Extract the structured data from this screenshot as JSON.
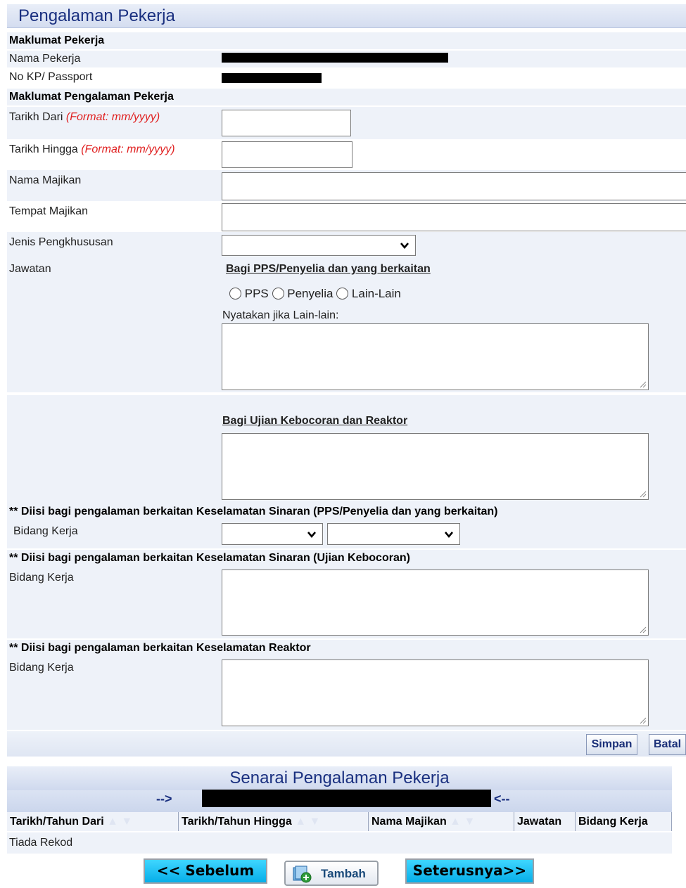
{
  "header": {
    "title": "Pengalaman Pekerja"
  },
  "maklumat_pekerja": {
    "title": "Maklumat Pekerja",
    "nama_label": "Nama Pekerja",
    "kp_label": "No KP/ Passport"
  },
  "pengalaman": {
    "title": "Maklumat Pengalaman Pekerja",
    "tarikh_dari_label": "Tarikh Dari ",
    "tarikh_hingga_label": "Tarikh Hingga ",
    "format_hint": "(Format: mm/yyyy)",
    "nama_majikan_label": "Nama Majikan",
    "tempat_majikan_label": "Tempat Majikan",
    "jenis_label": "Jenis Pengkhususan",
    "jawatan_label": "Jawatan",
    "pps_heading": "Bagi PPS/Penyelia dan yang berkaitan",
    "radio_options": [
      "PPS",
      "Penyelia",
      "Lain-Lain"
    ],
    "lain_label": "Nyatakan jika Lain-lain:",
    "kebocoran_heading": "Bagi Ujian Kebocoran dan Reaktor"
  },
  "sinaran_pps": {
    "title": "** Diisi bagi pengalaman berkaitan Keselamatan Sinaran (PPS/Penyelia dan yang berkaitan)",
    "bidang_label": "Bidang Kerja"
  },
  "sinaran_kebocoran": {
    "title": "** Diisi bagi pengalaman berkaitan Keselamatan Sinaran (Ujian Kebocoran)",
    "bidang_label": "Bidang Kerja"
  },
  "reaktor": {
    "title": "** Diisi bagi pengalaman berkaitan Keselamatan Reaktor",
    "bidang_label": "Bidang Kerja"
  },
  "actions": {
    "simpan": "Simpan",
    "batal": "Batal"
  },
  "senarai": {
    "title": "Senarai Pengalaman Pekerja",
    "arrow_left": "-->",
    "arrow_right": "<--",
    "columns": [
      "Tarikh/Tahun Dari",
      "Tarikh/Tahun Hingga",
      "Nama Majikan",
      "Jawatan",
      "Bidang Kerja"
    ],
    "empty": "Tiada Rekod"
  },
  "nav": {
    "sebelum": "<< Sebelum",
    "tambah": "Tambah",
    "seterusnya": "Seterusnya>>"
  }
}
